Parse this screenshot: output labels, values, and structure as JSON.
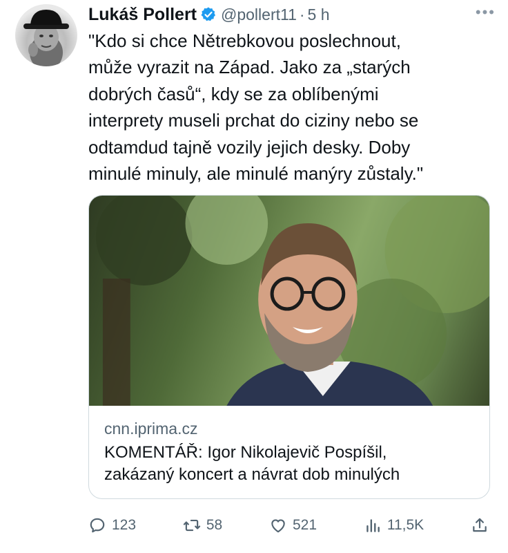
{
  "author": {
    "name": "Lukáš Pollert",
    "handle": "@pollert11",
    "separator": "·",
    "time": "5 h",
    "avatar_icon": "avatar-man-with-hat",
    "verified_icon": "verified-badge-icon",
    "verified_color": "#1d9bf0"
  },
  "tweet": {
    "text": "\"Kdo si chce Nětrebkovou poslechnout,\nmůže vyrazit na Západ. Jako za „starých\ndobrých časů“, kdy se za oblíbenými\ninterprety museli prchat do ciziny nebo se\nodtamdud tajně vozily jejich desky. Doby\nminulé minuly, ale minulé manýry zůstaly.\""
  },
  "card": {
    "domain": "cnn.iprima.cz",
    "title": "KOMENTÁŘ: Igor Nikolajevič Pospíšil,\nzakázaný koncert a návrat dob minulých",
    "image_icon": "article-photo-smiling-man-glasses"
  },
  "actions": {
    "replies": "123",
    "reposts": "58",
    "likes": "521",
    "views": "11,5K"
  },
  "colors": {
    "text": "#0f1419",
    "secondary": "#536471",
    "border": "#cfd9de",
    "accent": "#1d9bf0"
  }
}
